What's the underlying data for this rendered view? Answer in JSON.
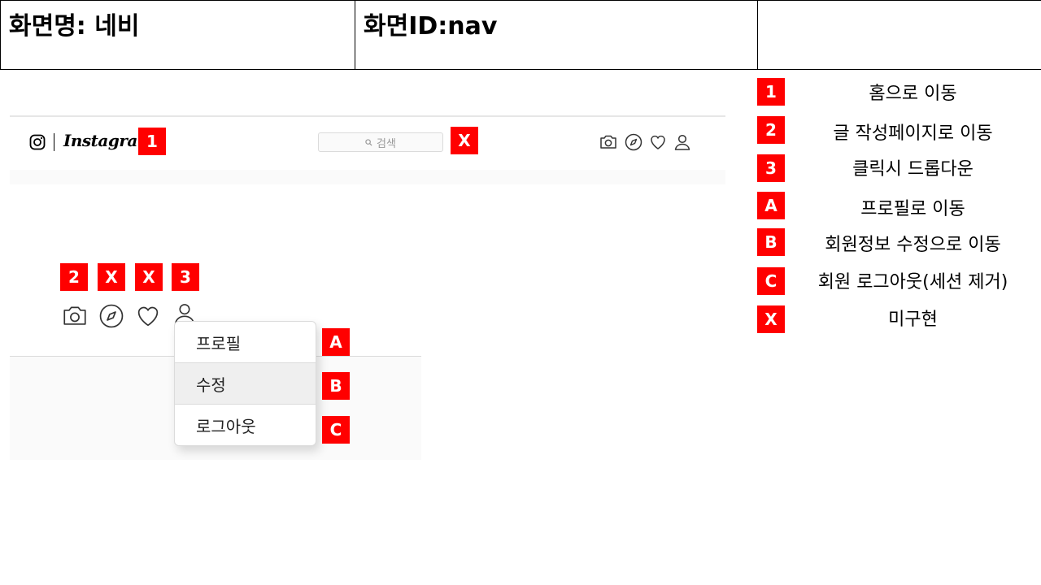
{
  "header": {
    "screen_name": "화면명: 네비",
    "screen_id": "화면ID:nav",
    "third": ""
  },
  "nav": {
    "logo_text": "Instagram",
    "search_placeholder": "검색",
    "icons": [
      "camera-icon",
      "compass-icon",
      "heart-icon",
      "user-icon"
    ]
  },
  "badges": {
    "b1": "1",
    "bx_search": "X",
    "b2": "2",
    "bx_compass": "X",
    "bx_heart": "X",
    "b3": "3",
    "ba": "A",
    "bb": "B",
    "bc": "C"
  },
  "dropdown": {
    "items": [
      "프로필",
      "수정",
      "로그아웃"
    ],
    "highlighted_index": 1
  },
  "legend": [
    {
      "key": "1",
      "text": "홈으로 이동"
    },
    {
      "key": "2",
      "text": "글 작성페이지로 이동"
    },
    {
      "key": "3",
      "text": "클릭시 드롭다운"
    },
    {
      "key": "A",
      "text": "프로필로 이동"
    },
    {
      "key": "B",
      "text": "회원정보 수정으로 이동"
    },
    {
      "key": "C",
      "text": "회원 로그아웃(세션 제거)"
    },
    {
      "key": "X",
      "text": "미구현"
    }
  ],
  "colors": {
    "badge": "#ff0000",
    "hover": "#efefef",
    "border": "#dbdbdb"
  }
}
